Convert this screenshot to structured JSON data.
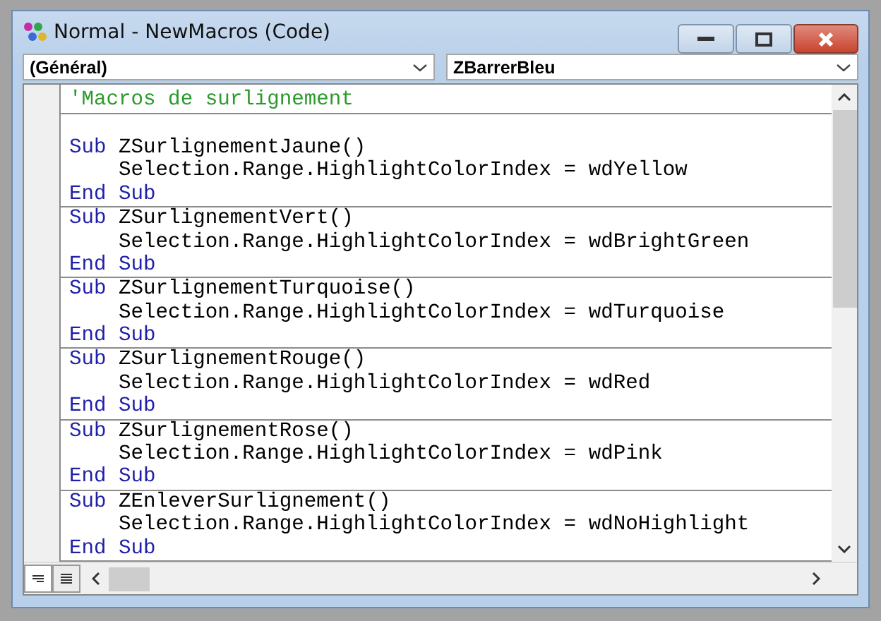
{
  "window": {
    "title": "Normal - NewMacros (Code)"
  },
  "object_dropdown": {
    "value": "(Général)"
  },
  "procedure_dropdown": {
    "value": "ZBarrerBleu"
  },
  "sections": [
    {
      "lines": [
        {
          "kind": "code",
          "segments": [
            {
              "kind": "comment",
              "text": "'Macros de surlignement"
            }
          ]
        }
      ]
    },
    {
      "lines": [
        {
          "kind": "blank"
        },
        {
          "kind": "code",
          "segments": [
            {
              "kind": "keyword",
              "text": "Sub"
            },
            {
              "kind": "plain",
              "text": " ZSurlignementJaune()"
            }
          ]
        },
        {
          "kind": "code",
          "segments": [
            {
              "kind": "plain",
              "text": "    Selection.Range.HighlightColorIndex = wdYellow"
            }
          ]
        },
        {
          "kind": "code",
          "segments": [
            {
              "kind": "keyword",
              "text": "End Sub"
            }
          ]
        }
      ]
    },
    {
      "lines": [
        {
          "kind": "code",
          "segments": [
            {
              "kind": "keyword",
              "text": "Sub"
            },
            {
              "kind": "plain",
              "text": " ZSurlignementVert()"
            }
          ]
        },
        {
          "kind": "code",
          "segments": [
            {
              "kind": "plain",
              "text": "    Selection.Range.HighlightColorIndex = wdBrightGreen"
            }
          ]
        },
        {
          "kind": "code",
          "segments": [
            {
              "kind": "keyword",
              "text": "End Sub"
            }
          ]
        }
      ]
    },
    {
      "lines": [
        {
          "kind": "code",
          "segments": [
            {
              "kind": "keyword",
              "text": "Sub"
            },
            {
              "kind": "plain",
              "text": " ZSurlignementTurquoise()"
            }
          ]
        },
        {
          "kind": "code",
          "segments": [
            {
              "kind": "plain",
              "text": "    Selection.Range.HighlightColorIndex = wdTurquoise"
            }
          ]
        },
        {
          "kind": "code",
          "segments": [
            {
              "kind": "keyword",
              "text": "End Sub"
            }
          ]
        }
      ]
    },
    {
      "lines": [
        {
          "kind": "code",
          "segments": [
            {
              "kind": "keyword",
              "text": "Sub"
            },
            {
              "kind": "plain",
              "text": " ZSurlignementRouge()"
            }
          ]
        },
        {
          "kind": "code",
          "segments": [
            {
              "kind": "plain",
              "text": "    Selection.Range.HighlightColorIndex = wdRed"
            }
          ]
        },
        {
          "kind": "code",
          "segments": [
            {
              "kind": "keyword",
              "text": "End Sub"
            }
          ]
        }
      ]
    },
    {
      "lines": [
        {
          "kind": "code",
          "segments": [
            {
              "kind": "keyword",
              "text": "Sub"
            },
            {
              "kind": "plain",
              "text": " ZSurlignementRose()"
            }
          ]
        },
        {
          "kind": "code",
          "segments": [
            {
              "kind": "plain",
              "text": "    Selection.Range.HighlightColorIndex = wdPink"
            }
          ]
        },
        {
          "kind": "code",
          "segments": [
            {
              "kind": "keyword",
              "text": "End Sub"
            }
          ]
        }
      ]
    },
    {
      "lines": [
        {
          "kind": "code",
          "segments": [
            {
              "kind": "keyword",
              "text": "Sub"
            },
            {
              "kind": "plain",
              "text": " ZEnleverSurlignement()"
            }
          ]
        },
        {
          "kind": "code",
          "segments": [
            {
              "kind": "plain",
              "text": "    Selection.Range.HighlightColorIndex = wdNoHighlight"
            }
          ]
        },
        {
          "kind": "code",
          "segments": [
            {
              "kind": "keyword",
              "text": "End Sub"
            }
          ]
        }
      ]
    }
  ]
}
